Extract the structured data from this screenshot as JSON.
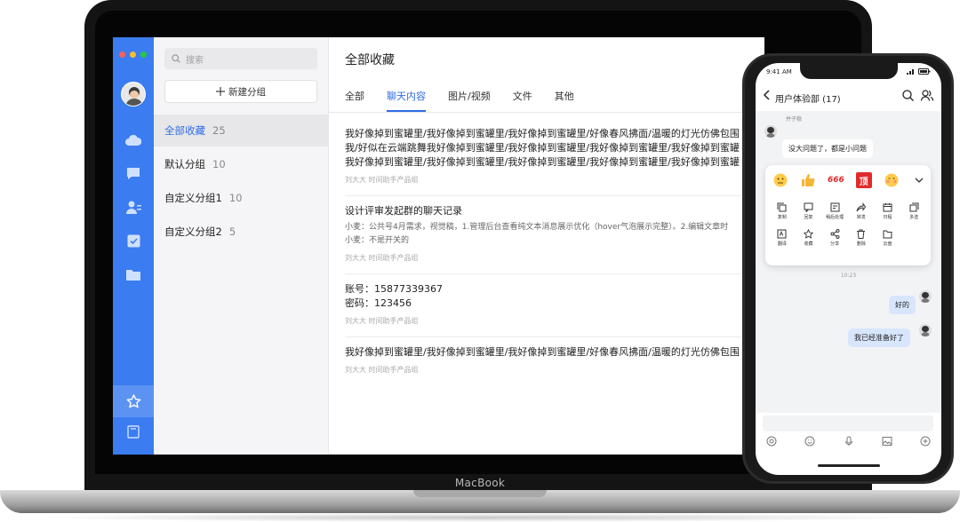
{
  "laptop": {
    "brand": "MacBook",
    "window_dots": [
      "#ff5f57",
      "#febc2e",
      "#28c840"
    ],
    "accent": "#3b7cf0"
  },
  "groups": {
    "search_placeholder": "搜索",
    "new_group_label": "新建分组",
    "items": [
      {
        "label": "全部收藏",
        "count": "25"
      },
      {
        "label": "默认分组",
        "count": "10"
      },
      {
        "label": "自定义分组1",
        "count": "10"
      },
      {
        "label": "自定义分组2",
        "count": "5"
      }
    ]
  },
  "content": {
    "title": "全部收藏",
    "tabs": [
      "全部",
      "聊天内容",
      "图片/视频",
      "文件",
      "其他"
    ],
    "items": [
      {
        "lines": [
          "我好像掉到蜜罐里/我好像掉到蜜罐里/我好像掉到蜜罐里/好像春风拂面/温暖的灯光仿佛包围",
          "我/好似在云端跳舞我好像掉到蜜罐里/我好像掉到蜜罐里/我好像掉到蜜罐里/我好像掉到蜜罐",
          "我好像掉到蜜罐里/我好像掉到蜜罐里/我好像掉到蜜罐里/我好像掉到蜜罐里/我好像掉到蜜罐"
        ],
        "meta": "刘大大  时间助手产品组"
      },
      {
        "lines": [
          "设计评审发起群的聊天记录"
        ],
        "subs": [
          "小麦：公共号4月需求，视觉稿，1.管理后台查看纯文本消息展示优化（hover气泡展示完整）。2.编辑文章时",
          "小麦：不是开关的"
        ],
        "meta": "刘大大  时间助手产品组"
      },
      {
        "lines": [
          "账号：15877339367",
          "密码：123456"
        ],
        "meta": "刘大大  时间助手产品组"
      },
      {
        "lines": [
          "我好像掉到蜜罐里/我好像掉到蜜罐里/我好像掉到蜜罐里/好像春风拂面/温暖的灯光仿佛包围"
        ],
        "meta": "刘大大  时间助手产品组"
      }
    ]
  },
  "phone": {
    "time": "9:41 AM",
    "title": "用户体验部 (17)",
    "sender": "并子稳",
    "msg_received": "没大问题了，都是小问题",
    "emojis": [
      "666",
      "顶"
    ],
    "actions": [
      "复制",
      "回复",
      "稍后处理",
      "转发",
      "日程",
      "多选",
      "翻译",
      "收藏",
      "分享",
      "删除",
      "云盘"
    ],
    "timestamp": "10:23",
    "msg_sent_1": "好的",
    "msg_sent_2": "我已经准备好了"
  }
}
